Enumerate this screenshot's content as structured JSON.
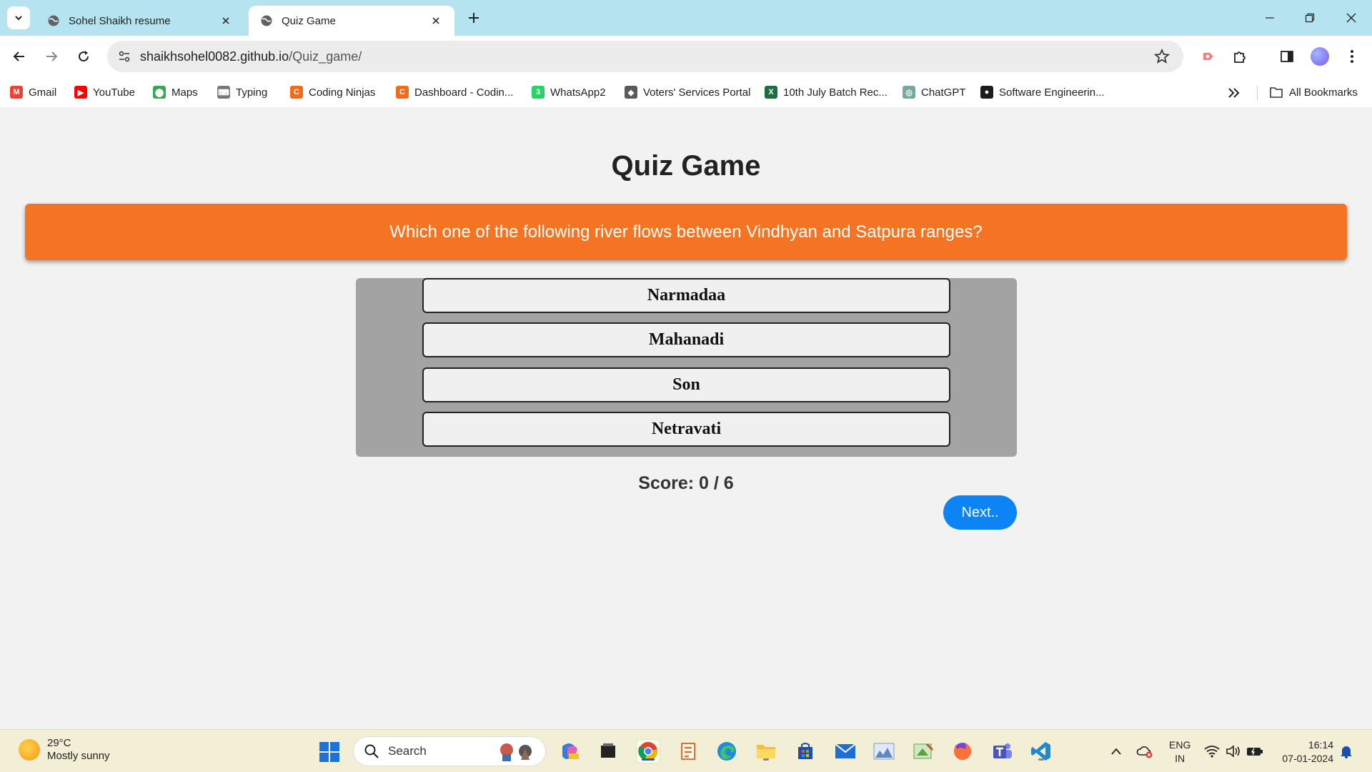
{
  "browser": {
    "tabs": [
      {
        "title": "Sohel Shaikh resume",
        "active": false
      },
      {
        "title": "Quiz Game",
        "active": true
      }
    ],
    "address": {
      "domain": "shaikhsohel0082.github.io",
      "path": "/Quiz_game/"
    },
    "bookmarks": [
      {
        "label": "Gmail",
        "icon": "gmail-icon",
        "color": "#ea4335",
        "glyph": "M"
      },
      {
        "label": "YouTube",
        "icon": "youtube-icon",
        "color": "#ff0000",
        "glyph": "▶"
      },
      {
        "label": "Maps",
        "icon": "maps-icon",
        "color": "#34a853",
        "glyph": "⬤"
      },
      {
        "label": "Typing",
        "icon": "typing-icon",
        "color": "#777777",
        "glyph": "⌨"
      },
      {
        "label": "Coding Ninjas",
        "icon": "coding-ninjas-icon",
        "color": "#f26b1d",
        "glyph": "C"
      },
      {
        "label": "Dashboard - Codin...",
        "icon": "coding-ninjas-icon",
        "color": "#f26b1d",
        "glyph": "C"
      },
      {
        "label": "WhatsApp2",
        "icon": "whatsapp-icon",
        "color": "#25d366",
        "glyph": "3"
      },
      {
        "label": "Voters' Services Portal",
        "icon": "voters-portal-icon",
        "color": "#5a5a5a",
        "glyph": "◆"
      },
      {
        "label": "10th July Batch Rec...",
        "icon": "excel-icon",
        "color": "#1d6f42",
        "glyph": "X"
      },
      {
        "label": "ChatGPT",
        "icon": "chatgpt-icon",
        "color": "#74aa9c",
        "glyph": "◎"
      },
      {
        "label": "Software Engineerin...",
        "icon": "software-engineering-icon",
        "color": "#1c1c1c",
        "glyph": "●"
      }
    ],
    "all_bookmarks_label": "All Bookmarks"
  },
  "quiz": {
    "title": "Quiz Game",
    "question": "Which one of the following river flows between Vindhyan and Satpura ranges?",
    "options": [
      "Narmadaa",
      "Mahanadi",
      "Son",
      "Netravati"
    ],
    "score_label": "Score: 0 / 6",
    "next_label": "Next.."
  },
  "colors": {
    "question_bg": "#f47424",
    "options_panel_bg": "#a3a3a3",
    "next_button_bg": "#0d84f5"
  },
  "taskbar": {
    "weather_temp": "29°C",
    "weather_desc": "Mostly sunny",
    "search_label": "Search",
    "lang_line1": "ENG",
    "lang_line2": "IN",
    "time": "16:14",
    "date": "07-01-2024"
  }
}
